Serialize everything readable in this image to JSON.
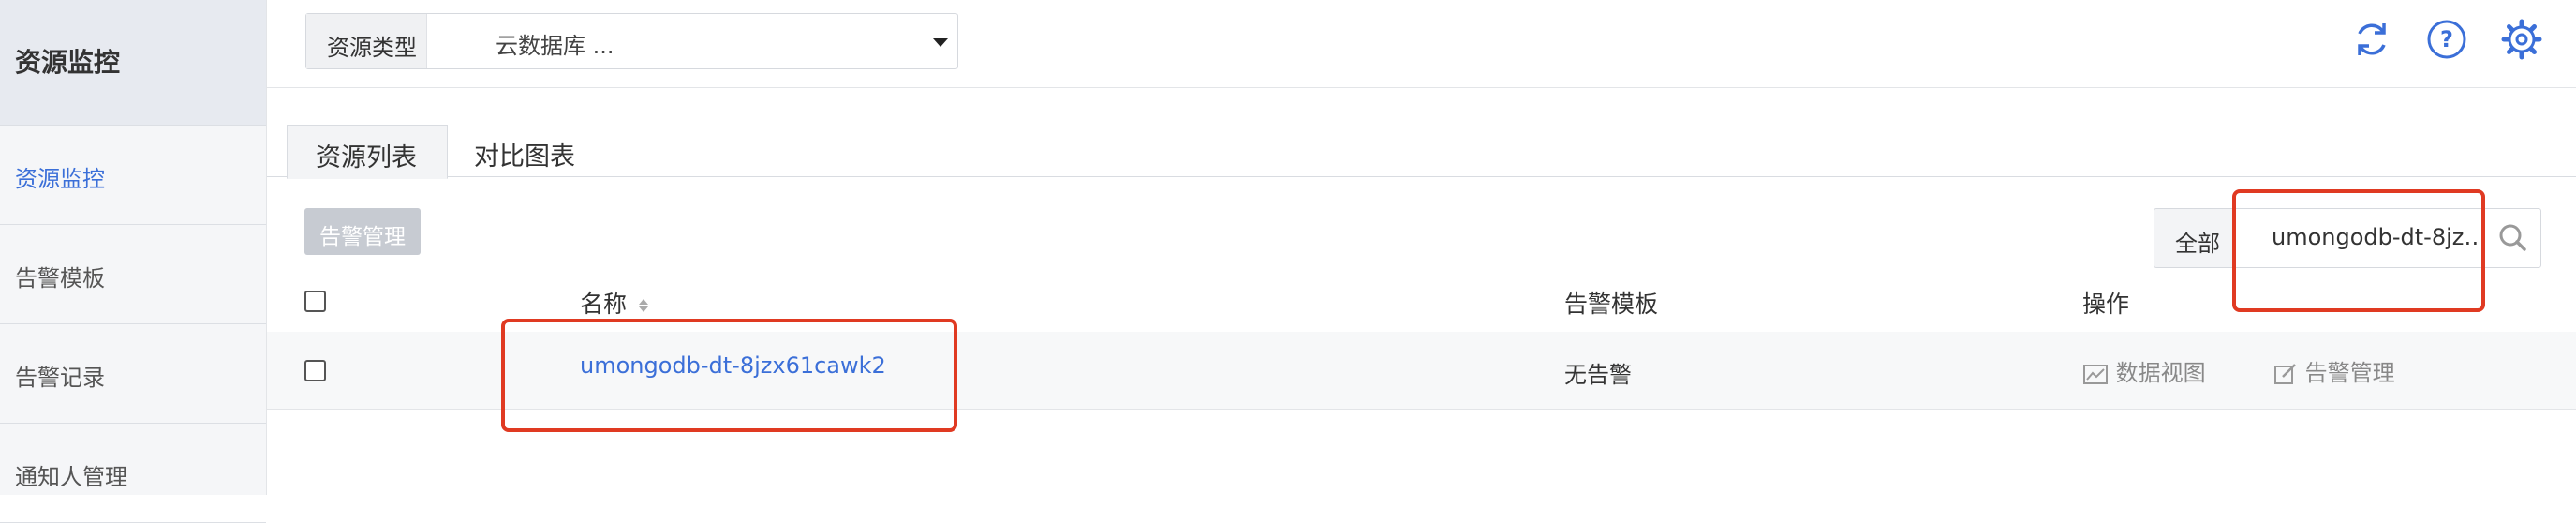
{
  "sidebar": {
    "title": "资源监控",
    "items": [
      {
        "label": "资源监控",
        "active": true
      },
      {
        "label": "告警模板",
        "active": false
      },
      {
        "label": "告警记录",
        "active": false
      },
      {
        "label": "通知人管理",
        "active": false
      }
    ]
  },
  "topbar": {
    "resource_type_label": "资源类型",
    "resource_type_value": "云数据库 ...",
    "icons": [
      "refresh-icon",
      "help-icon",
      "settings-icon"
    ]
  },
  "tabs": [
    {
      "label": "资源列表",
      "active": true
    },
    {
      "label": "对比图表",
      "active": false
    }
  ],
  "toolbar": {
    "alert_manage_label": "告警管理"
  },
  "search": {
    "filter_label": "全部",
    "value": "umongodb-dt-8jzx61cawk2"
  },
  "table": {
    "headers": {
      "name": "名称",
      "template": "告警模板",
      "actions": "操作"
    },
    "rows": [
      {
        "name": "umongodb-dt-8jzx61cawk2",
        "template": "无告警",
        "action_view": "数据视图",
        "action_alert": "告警管理"
      }
    ]
  },
  "colors": {
    "accent": "#3b6fd8",
    "highlight": "#e03a22",
    "sidebar_bg": "#f5f6f8"
  }
}
